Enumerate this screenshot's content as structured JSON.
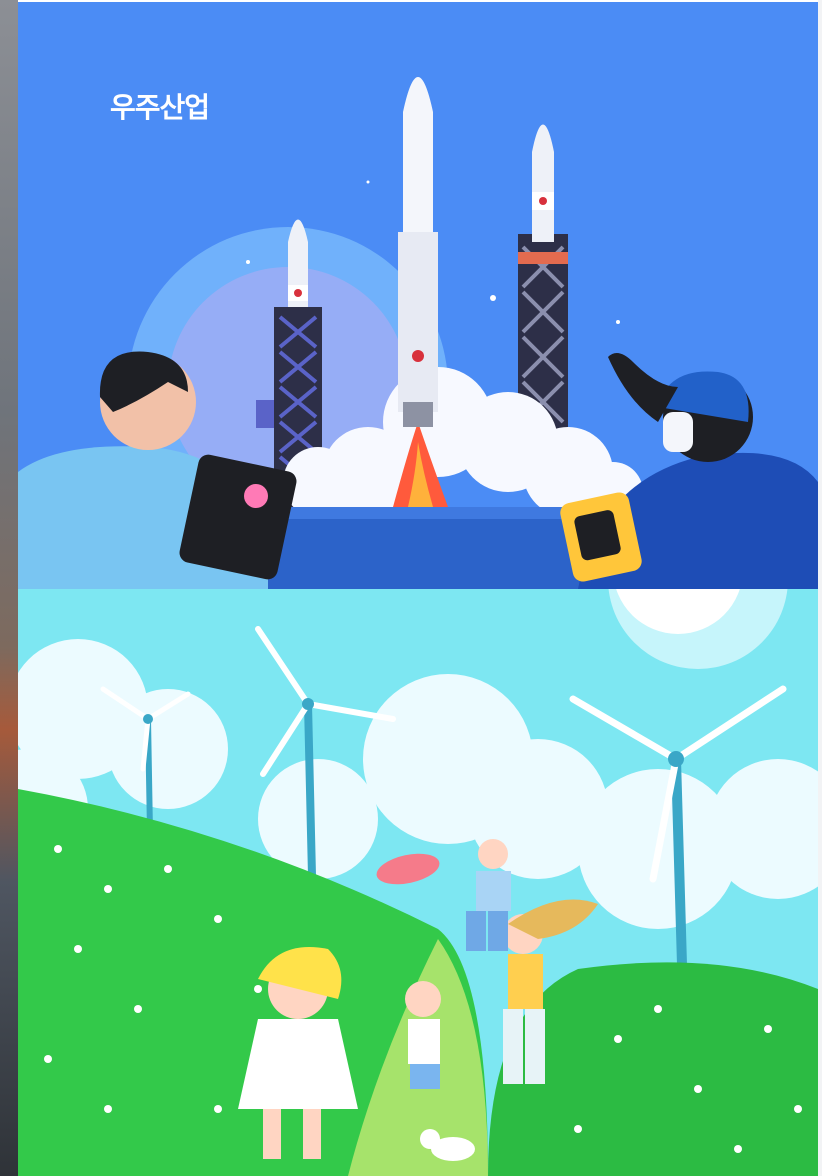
{
  "panels": [
    {
      "title": "우주산업",
      "illustration": "rocket-launch-illustration",
      "colors": {
        "background": "#4b8cf5",
        "rocket": "#f4f6fb",
        "flame": "#ff5a3c",
        "tower": "#2d2f48"
      }
    },
    {
      "title": "",
      "illustration": "wind-turbine-meadow-illustration",
      "colors": {
        "sky": "#7de7f2",
        "grass": "#33c94a",
        "cloud": "#e9fbff",
        "turbine": "#ffffff"
      }
    }
  ]
}
